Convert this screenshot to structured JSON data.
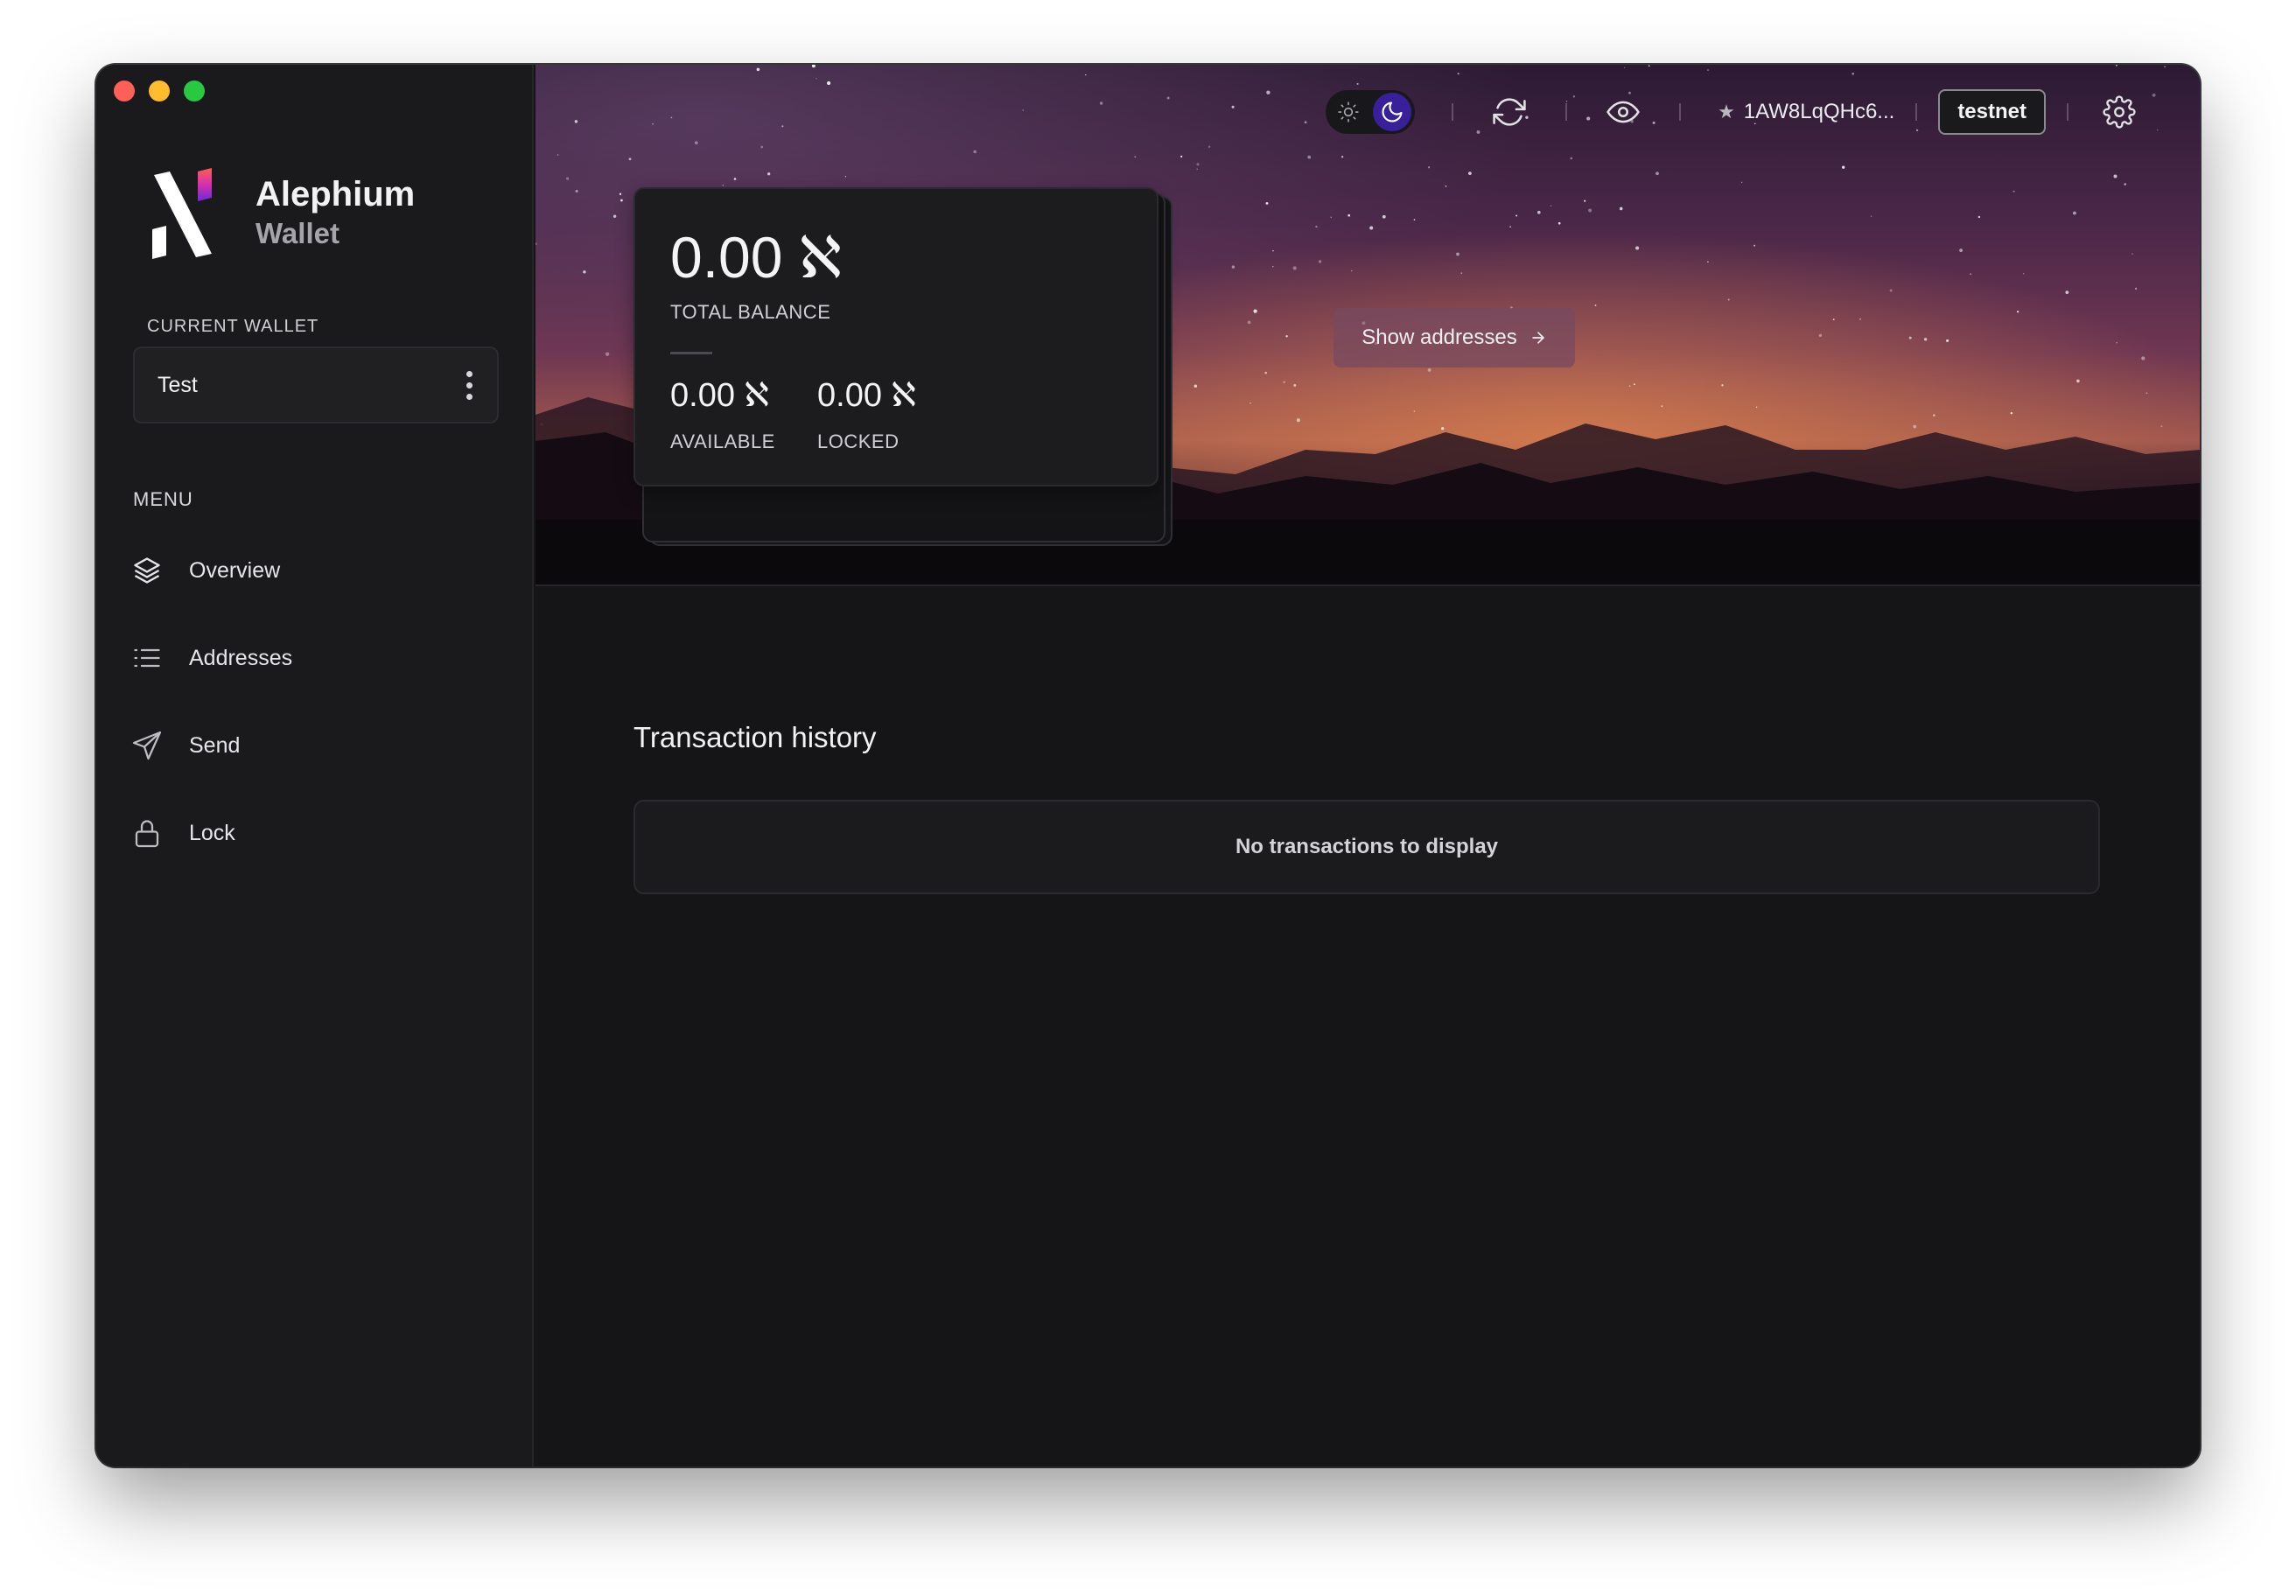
{
  "app": {
    "brand_name": "Alephium",
    "brand_sub": "Wallet"
  },
  "sidebar": {
    "current_wallet_label": "CURRENT WALLET",
    "wallet_name": "Test",
    "menu_label": "MENU",
    "items": [
      {
        "label": "Overview",
        "icon": "layers-icon"
      },
      {
        "label": "Addresses",
        "icon": "list-icon"
      },
      {
        "label": "Send",
        "icon": "send-icon"
      },
      {
        "label": "Lock",
        "icon": "lock-icon"
      }
    ]
  },
  "topbar": {
    "theme": "dark",
    "default_address": "1AW8LqQHc6...",
    "network": "testnet"
  },
  "balance": {
    "total_value": "0.00",
    "total_label": "TOTAL BALANCE",
    "available_value": "0.00",
    "available_label": "AVAILABLE",
    "locked_value": "0.00",
    "locked_label": "LOCKED",
    "currency_symbol": "ℵ"
  },
  "actions": {
    "show_addresses": "Show addresses"
  },
  "transactions": {
    "title": "Transaction history",
    "empty_message": "No transactions to display"
  },
  "colors": {
    "accent": "#3a1f9a",
    "background": "#151517",
    "sidebar": "#1a1a1c"
  }
}
